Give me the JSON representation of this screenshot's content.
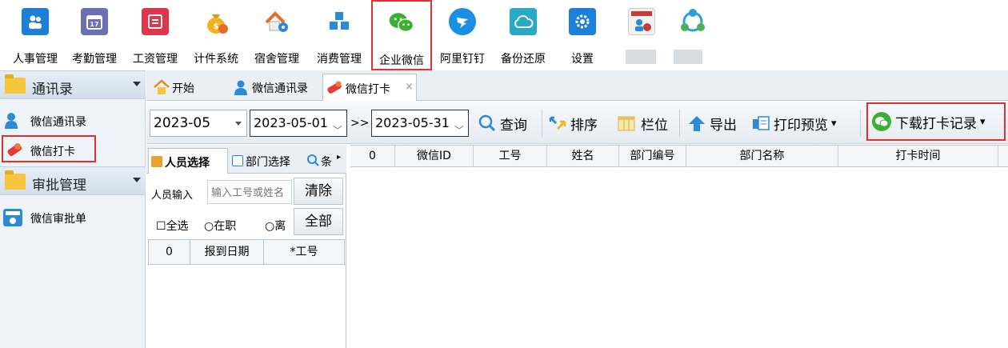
{
  "ribbon": {
    "items": [
      {
        "label": "人事管理",
        "icon": "people-icon",
        "color": "#1e7fd6"
      },
      {
        "label": "考勤管理",
        "icon": "calendar-icon",
        "color": "#6d6fb5"
      },
      {
        "label": "工资管理",
        "icon": "wallet-icon",
        "color": "#e0344a"
      },
      {
        "label": "计件系统",
        "icon": "money-bag-icon",
        "color": "#f2b21e"
      },
      {
        "label": "宿舍管理",
        "icon": "house-gear-icon",
        "color": "#e86a2a"
      },
      {
        "label": "消费管理",
        "icon": "cubes-icon",
        "color": "#2d8ad6"
      },
      {
        "label": "企业微信",
        "icon": "wechat-icon",
        "color": "#3cb034"
      },
      {
        "label": "阿里钉钉",
        "icon": "dingtalk-icon",
        "color": "#1a8fe3"
      },
      {
        "label": "备份还原",
        "icon": "cloud-icon",
        "color": "#28a9c7"
      },
      {
        "label": "设置",
        "icon": "gear-icon",
        "color": "#1e7fd6"
      },
      {
        "label": "",
        "icon": "calendar-person-icon",
        "color": "#c93a3a"
      },
      {
        "label": "",
        "icon": "network-icon",
        "color": "#2aa0d8"
      }
    ]
  },
  "leftnav": {
    "groups": [
      {
        "label": "通讯录",
        "items": [
          {
            "label": "微信通讯录",
            "icon": "contact-icon"
          },
          {
            "label": "微信打卡",
            "icon": "punch-icon"
          }
        ]
      },
      {
        "label": "审批管理",
        "items": [
          {
            "label": "微信审批单",
            "icon": "approval-icon"
          }
        ]
      }
    ]
  },
  "tabs": [
    {
      "label": "开始",
      "icon": "home-icon"
    },
    {
      "label": "微信通讯录",
      "icon": "contact-icon"
    },
    {
      "label": "微信打卡",
      "icon": "punch-icon",
      "close": "×"
    }
  ],
  "toolbar": {
    "month": "2023-05",
    "start_date": "2023-05-01",
    "range_sep": ">>",
    "end_date": "2023-05-31",
    "query": "查询",
    "sort": "排序",
    "columns": "栏位",
    "export": "导出",
    "print_preview": "打印预览",
    "download": "下载打卡记录"
  },
  "person_panel": {
    "tabs": [
      "人员选择",
      "部门选择",
      "条"
    ],
    "input_label": "人员输入",
    "input_placeholder": "输入工号或姓名",
    "clear": "清除",
    "all": "全部",
    "select_all": "全选",
    "on_job": "在职",
    "resigned": "离",
    "grid_headers": [
      "0",
      "报到日期",
      "*工号"
    ]
  },
  "main_grid": {
    "headers": [
      "0",
      "微信ID",
      "工号",
      "姓名",
      "部门编号",
      "部门名称",
      "打卡时间"
    ]
  }
}
